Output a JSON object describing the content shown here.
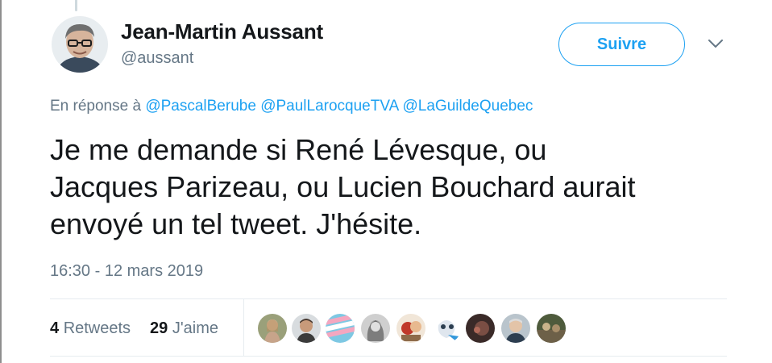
{
  "author": {
    "name": "Jean-Martin Aussant",
    "handle": "@aussant"
  },
  "follow_label": "Suivre",
  "reply": {
    "prefix": "En réponse à",
    "mentions": [
      "@PascalBerube",
      "@PaulLarocqueTVA",
      "@LaGuildeQuebec"
    ]
  },
  "tweet": {
    "lines": [
      "Je me demande si René Lévesque, ou",
      "Jacques Parizeau, ou Lucien Bouchard aurait",
      "envoyé un tel tweet. J'hésite."
    ],
    "timestamp": "16:30 - 12 mars 2019"
  },
  "stats": {
    "retweets_count": "4",
    "retweets_label": "Retweets",
    "likes_count": "29",
    "likes_label": "J'aime"
  },
  "colors": {
    "accent": "#1da1f2",
    "secondary_text": "#657786",
    "primary_text": "#14171a",
    "divider": "#e6ecf0"
  }
}
